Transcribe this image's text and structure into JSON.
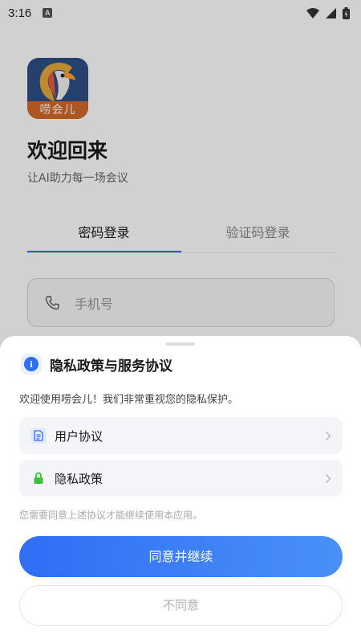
{
  "status_bar": {
    "time": "3:16",
    "notification_icon_letter": "A"
  },
  "app": {
    "logo_text": "唠会儿",
    "welcome_title": "欢迎回来",
    "welcome_subtitle": "让AI助力每一场会议",
    "tabs": [
      {
        "label": "密码登录",
        "active": true
      },
      {
        "label": "验证码登录",
        "active": false
      }
    ],
    "phone_input": {
      "placeholder": "手机号",
      "value": ""
    }
  },
  "dialog": {
    "title": "隐私政策与服务协议",
    "description": "欢迎使用唠会儿！我们非常重视您的隐私保护。",
    "items": [
      {
        "label": "用户协议",
        "icon": "document-icon"
      },
      {
        "label": "隐私政策",
        "icon": "lock-icon"
      }
    ],
    "notice": "您需要同意上述协议才能继续使用本应用。",
    "agree_label": "同意并继续",
    "disagree_label": "不同意"
  },
  "colors": {
    "accent": "#2f6ef6",
    "lock_green": "#3cc13b",
    "logo_bg": "#2f4f86",
    "logo_band": "#d46a2a"
  }
}
